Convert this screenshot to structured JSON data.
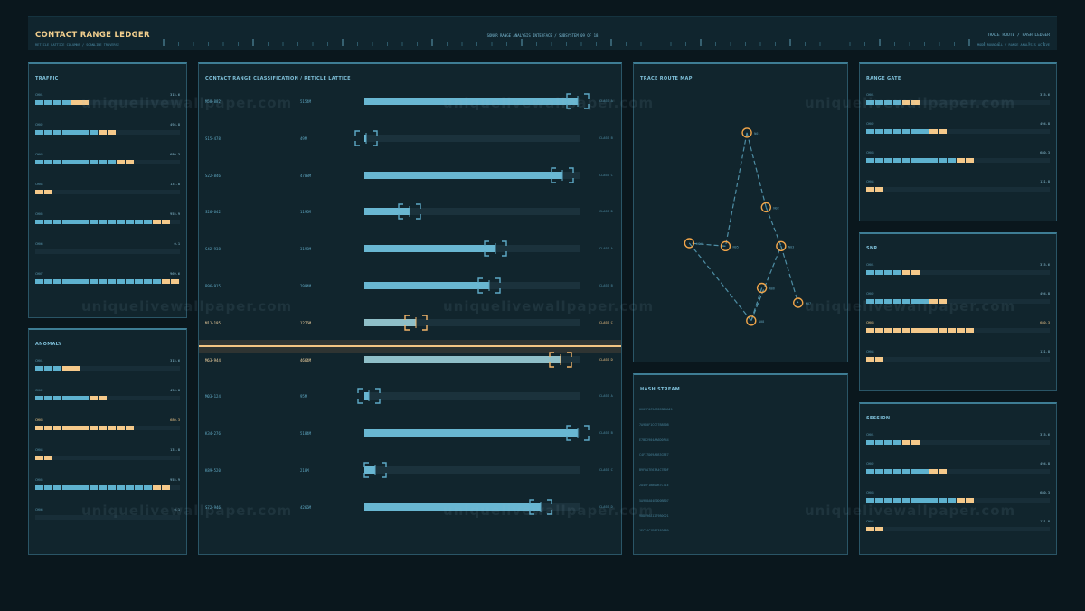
{
  "header": {
    "title": "CONTACT RANGE LEDGER",
    "subtitle": "RETICLE LATTICE COLUMNS / SCANLINE TRAVERSE",
    "center": "SONAR RANGE ANALYSIS INTERFACE / SUBSYSTEM 09 OF 18",
    "right": "TRACE ROUTE / HASH LEDGER",
    "right_sub": "MODE ROUNDALL / RANGE ANALYSIS ACTIVE"
  },
  "watermark": "uniquelivewallpaper.com",
  "colors": {
    "cyan": "#5eb2cf",
    "amber": "#f5c98a",
    "panel": "#11252d",
    "background": "#0a171d"
  },
  "traffic": {
    "title": "TRAFFIC",
    "rows": [
      {
        "label": "CHN1",
        "value": "315.6",
        "cyan": 4,
        "amber": 2
      },
      {
        "label": "CHN2",
        "value": "494.8",
        "cyan": 7,
        "amber": 2
      },
      {
        "label": "CHN3",
        "value": "680.3",
        "cyan": 9,
        "amber": 2
      },
      {
        "label": "CHN4",
        "value": "131.8",
        "cyan": 0,
        "amber": 2
      },
      {
        "label": "CHN5",
        "value": "955.9",
        "cyan": 13,
        "amber": 2
      },
      {
        "label": "CHN6",
        "value": "0.1",
        "cyan": 0,
        "amber": 0
      },
      {
        "label": "CHN7",
        "value": "969.6",
        "cyan": 14,
        "amber": 2
      }
    ]
  },
  "anomaly": {
    "title": "ANOMALY",
    "rows": [
      {
        "label": "CHN1",
        "value": "315.6",
        "cyan": 3,
        "amber": 2,
        "hot": false
      },
      {
        "label": "CHN2",
        "value": "494.8",
        "cyan": 6,
        "amber": 2,
        "hot": false
      },
      {
        "label": "CHN3",
        "value": "680.3",
        "cyan": 0,
        "amber": 11,
        "hot": true
      },
      {
        "label": "CHN4",
        "value": "131.8",
        "cyan": 0,
        "amber": 2,
        "hot": false
      },
      {
        "label": "CHN5",
        "value": "955.9",
        "cyan": 13,
        "amber": 2,
        "hot": false
      },
      {
        "label": "CHN6",
        "value": "0.1",
        "cyan": 0,
        "amber": 0,
        "hot": false
      }
    ]
  },
  "lattice": {
    "title": "CONTACT RANGE CLASSIFICATION / RETICLE LATTICE",
    "rows": [
      {
        "id": "M58-882",
        "range": "5154M",
        "cls": "CLASS A",
        "fill": 0.99,
        "active": false
      },
      {
        "id": "S15-478",
        "range": "49M",
        "cls": "CLASS B",
        "fill": 0.01,
        "active": false
      },
      {
        "id": "S22-846",
        "range": "4708M",
        "cls": "CLASS C",
        "fill": 0.92,
        "active": false
      },
      {
        "id": "S26-642",
        "range": "1195M",
        "cls": "CLASS D",
        "fill": 0.21,
        "active": false
      },
      {
        "id": "S42-938",
        "range": "3193M",
        "cls": "CLASS A",
        "fill": 0.61,
        "active": false
      },
      {
        "id": "B96-915",
        "range": "2994M",
        "cls": "CLASS B",
        "fill": 0.58,
        "active": false
      },
      {
        "id": "M11-195",
        "range": "1276M",
        "cls": "CLASS C",
        "fill": 0.24,
        "active": true
      },
      {
        "id": "M63-944",
        "range": "4664M",
        "cls": "CLASS D",
        "fill": 0.91,
        "active": true
      },
      {
        "id": "M03-124",
        "range": "95M",
        "cls": "CLASS A",
        "fill": 0.02,
        "active": false
      },
      {
        "id": "K34-276",
        "range": "5184M",
        "cls": "CLASS B",
        "fill": 0.99,
        "active": false
      },
      {
        "id": "K89-520",
        "range": "218M",
        "cls": "CLASS C",
        "fill": 0.05,
        "active": false
      },
      {
        "id": "S72-946",
        "range": "4266M",
        "cls": "CLASS D",
        "fill": 0.82,
        "active": false
      }
    ]
  },
  "trace_map": {
    "title": "TRACE ROUTE MAP",
    "nodes": [
      {
        "label": "N01"
      },
      {
        "label": "N02"
      },
      {
        "label": "N03"
      },
      {
        "label": "N04"
      },
      {
        "label": "N05"
      },
      {
        "label": "N06"
      },
      {
        "label": "N07"
      },
      {
        "label": "N08"
      }
    ]
  },
  "hash_stream": {
    "title": "HASH STREAM",
    "lines": [
      "0X07F0C9AB3E8D4A21",
      "7A9D0F1CCE7B8E0B",
      "E7BD2904AA6D0F44",
      "C4F17D69A5B3CBE7",
      "B9F8A7E63A4C7B0F",
      "2A4CF1BB00B7C71E",
      "5A9F8A04E0D0BB07",
      "90DC96A1279B0C21",
      "1EC34C1D8F3F0F80"
    ]
  },
  "range_gate": {
    "title": "RANGE GATE",
    "rows": [
      {
        "label": "CHN1",
        "value": "315.6",
        "cyan": 4,
        "amber": 2,
        "hot": false
      },
      {
        "label": "CHN2",
        "value": "494.8",
        "cyan": 7,
        "amber": 2,
        "hot": false
      },
      {
        "label": "CHN3",
        "value": "680.3",
        "cyan": 10,
        "amber": 2,
        "hot": false
      },
      {
        "label": "CHN4",
        "value": "131.8",
        "cyan": 0,
        "amber": 2,
        "hot": false
      }
    ]
  },
  "snr": {
    "title": "SNR",
    "rows": [
      {
        "label": "CHN1",
        "value": "315.6",
        "cyan": 4,
        "amber": 2,
        "hot": false
      },
      {
        "label": "CHN2",
        "value": "494.8",
        "cyan": 7,
        "amber": 2,
        "hot": false
      },
      {
        "label": "CHN3",
        "value": "680.3",
        "cyan": 0,
        "amber": 12,
        "hot": true
      },
      {
        "label": "CHN4",
        "value": "131.8",
        "cyan": 0,
        "amber": 2,
        "hot": false
      }
    ]
  },
  "session": {
    "title": "SESSION",
    "rows": [
      {
        "label": "CHN1",
        "value": "315.6",
        "cyan": 4,
        "amber": 2,
        "hot": false
      },
      {
        "label": "CHN2",
        "value": "494.8",
        "cyan": 7,
        "amber": 2,
        "hot": false
      },
      {
        "label": "CHN3",
        "value": "680.3",
        "cyan": 10,
        "amber": 2,
        "hot": false
      },
      {
        "label": "CHN4",
        "value": "131.8",
        "cyan": 0,
        "amber": 2,
        "hot": false
      }
    ]
  }
}
